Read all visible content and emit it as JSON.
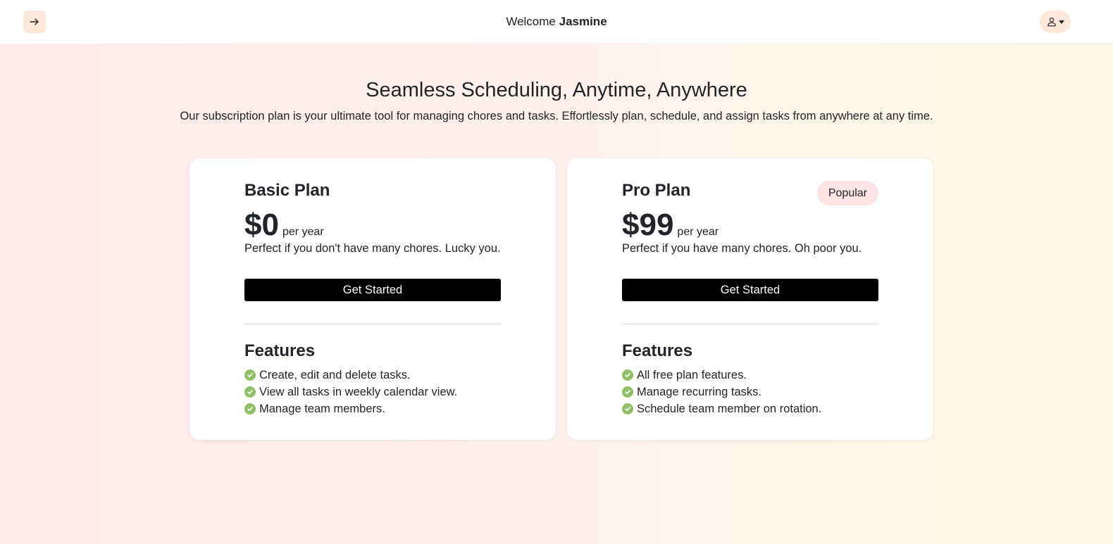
{
  "header": {
    "welcome_prefix": "Welcome",
    "user_name": "Jasmine",
    "menu_icon": "arrow-right-icon",
    "user_icon": "person-icon"
  },
  "hero": {
    "title": "Seamless Scheduling, Anytime, Anywhere",
    "subtitle": "Our subscription plan is your ultimate tool for managing chores and tasks. Effortlessly plan, schedule, and assign tasks from anywhere at any time."
  },
  "plans": [
    {
      "name": "Basic Plan",
      "price": "$0",
      "period": "per year",
      "description": "Perfect if you don't have many chores. Lucky you.",
      "cta_label": "Get Started",
      "features_title": "Features",
      "features": [
        "Create, edit and delete tasks.",
        "View all tasks in weekly calendar view.",
        "Manage team members."
      ]
    },
    {
      "name": "Pro Plan",
      "badge": "Popular",
      "price": "$99",
      "period": "per year",
      "description": "Perfect if you have many chores. Oh poor you.",
      "cta_label": "Get Started",
      "features_title": "Features",
      "features": [
        "All free plan features.",
        "Manage recurring tasks.",
        "Schedule team member on rotation."
      ]
    }
  ],
  "colors": {
    "accent_bg": "#fde8da",
    "badge_bg": "#fde4e4",
    "check": "#8fc069",
    "cta_bg": "#000000"
  }
}
